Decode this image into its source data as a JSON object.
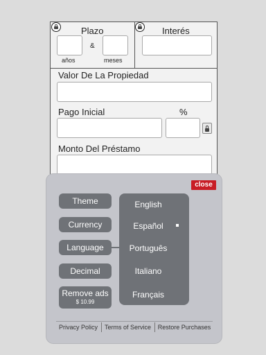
{
  "form": {
    "plazo": {
      "label": "Plazo",
      "anos_label": "años",
      "meses_label": "meses",
      "and_label": "&",
      "anos_value": "",
      "meses_value": ""
    },
    "interes": {
      "label": "Interés",
      "value": ""
    },
    "valor": {
      "label": "Valor De La Propiedad",
      "value": ""
    },
    "pago": {
      "label": "Pago Inicial",
      "percent_label": "%",
      "value": "",
      "percent_value": ""
    },
    "monto": {
      "label": "Monto Del Préstamo",
      "value": ""
    }
  },
  "settings": {
    "close_label": "close",
    "buttons": {
      "theme": "Theme",
      "currency": "Currency",
      "language": "Language",
      "decimal": "Decimal",
      "remove_ads": "Remove ads",
      "remove_ads_price": "$ 10.99"
    },
    "languages": [
      "English",
      "Español",
      "Português",
      "Italiano",
      "Français"
    ],
    "selected_language": "Español",
    "footer": {
      "privacy": "Privacy Policy",
      "terms": "Terms of Service",
      "restore": "Restore Purchases"
    }
  },
  "colors": {
    "close_button": "#c81d25",
    "button_bg": "#6f7277",
    "modal_bg": "#c4c5cb",
    "form_bg": "#f2f2f2"
  },
  "icons": [
    "lock-icon"
  ]
}
